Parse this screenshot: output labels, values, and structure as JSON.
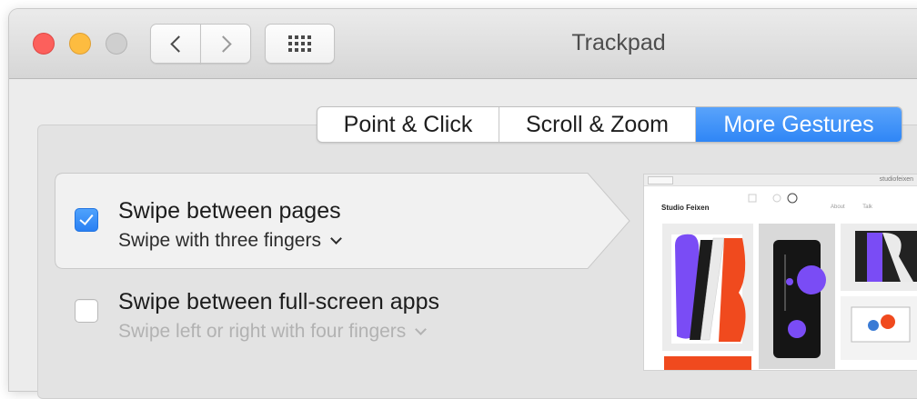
{
  "window": {
    "title": "Trackpad"
  },
  "tabs": [
    {
      "label": "Point & Click",
      "selected": false
    },
    {
      "label": "Scroll & Zoom",
      "selected": false
    },
    {
      "label": "More Gestures",
      "selected": true
    }
  ],
  "options": [
    {
      "title": "Swipe between pages",
      "subtitle": "Swipe with three fingers",
      "checked": true
    },
    {
      "title": "Swipe between full-screen apps",
      "subtitle": "Swipe left or right with four fingers",
      "checked": false
    }
  ],
  "preview": {
    "brand": "Studio Feixen",
    "url": "studiofeixen",
    "nav_links": "About Talk"
  },
  "colors": {
    "accent": "#2f86f6",
    "close": "#fc605c",
    "minimize": "#fdbc40",
    "art_purple": "#7a4cf5",
    "art_orange": "#f04a1e"
  },
  "icons": [
    "back-icon",
    "forward-icon",
    "grid-icon",
    "chevron-down-icon",
    "checkmark-icon"
  ]
}
